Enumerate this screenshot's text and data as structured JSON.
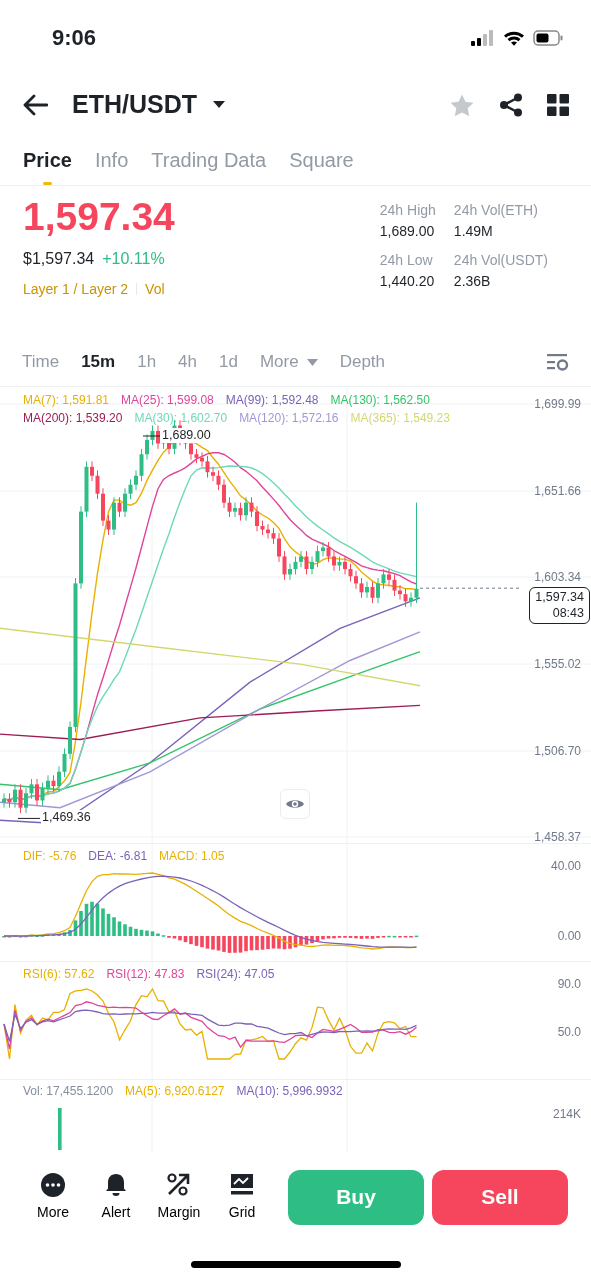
{
  "status_bar": {
    "time": "9:06"
  },
  "header": {
    "pair": "ETH/USDT",
    "favorited": false
  },
  "tabs": [
    {
      "label": "Price",
      "selected": true
    },
    {
      "label": "Info",
      "selected": false
    },
    {
      "label": "Trading Data",
      "selected": false
    },
    {
      "label": "Square",
      "selected": false
    }
  ],
  "price": {
    "last": "1,597.34",
    "usd": "$1,597.34",
    "change": "+10.11%",
    "tags": [
      "Layer 1 / Layer 2",
      "Vol"
    ]
  },
  "stats": [
    {
      "label": "24h High",
      "value": "1,689.00"
    },
    {
      "label": "24h Vol(ETH)",
      "value": "1.49M"
    },
    {
      "label": "24h Low",
      "value": "1,440.20"
    },
    {
      "label": "24h Vol(USDT)",
      "value": "2.36B"
    }
  ],
  "intervals": [
    {
      "label": "Time",
      "selected": false,
      "kind": "plain"
    },
    {
      "label": "15m",
      "selected": true,
      "kind": "plain"
    },
    {
      "label": "1h",
      "selected": false,
      "kind": "plain"
    },
    {
      "label": "4h",
      "selected": false,
      "kind": "plain"
    },
    {
      "label": "1d",
      "selected": false,
      "kind": "plain"
    },
    {
      "label": "More",
      "selected": false,
      "kind": "dropdown"
    },
    {
      "label": "Depth",
      "selected": false,
      "kind": "plain"
    }
  ],
  "price_chart": {
    "legend": [
      {
        "label": "MA(7): 1,591.81",
        "color": "#e8b100"
      },
      {
        "label": "MA(25): 1,599.08",
        "color": "#e0449a"
      },
      {
        "label": "MA(99): 1,592.48",
        "color": "#7b62b8"
      },
      {
        "label": "MA(130): 1,562.50",
        "color": "#33c46a"
      },
      {
        "label": "MA(200): 1,539.20",
        "color": "#9c1c55"
      },
      {
        "label": "MA(30): 1,602.70",
        "color": "#6ed8b8"
      },
      {
        "label": "MA(120): 1,572.16",
        "color": "#9f97d8"
      },
      {
        "label": "MA(365): 1,549.23",
        "color": "#d2d86e"
      }
    ],
    "y_labels": [
      "1,699.99",
      "1,651.66",
      "1,603.34",
      "1,555.02",
      "1,506.70",
      "1,458.37"
    ],
    "high_label": "1,689.00",
    "low_label": "1,469.36",
    "current_price": "1,597.34",
    "countdown": "08:43"
  },
  "macd": {
    "legend": [
      {
        "label": "DIF: -5.76",
        "color": "#e8b100"
      },
      {
        "label": "DEA: -6.81",
        "color": "#7b62b8"
      },
      {
        "label": "MACD: 1.05",
        "color": "#e8b100"
      }
    ],
    "y_labels": [
      "40.00",
      "0.00"
    ]
  },
  "rsi": {
    "legend": [
      {
        "label": "RSI(6): 57.62",
        "color": "#e8b100"
      },
      {
        "label": "RSI(12): 47.83",
        "color": "#e0449a"
      },
      {
        "label": "RSI(24): 47.05",
        "color": "#7b62b8"
      }
    ],
    "y_labels": [
      "90.0",
      "50.0"
    ]
  },
  "volume": {
    "legend": [
      {
        "label": "Vol: 17,455.1200",
        "color": "#848e9c"
      },
      {
        "label": "MA(5): 6,920.6127",
        "color": "#e8b100"
      },
      {
        "label": "MA(10): 5,996.9932",
        "color": "#7b62b8"
      }
    ],
    "y_labels": [
      "214K"
    ]
  },
  "bottom_actions": [
    {
      "label": "More",
      "kind": "more"
    },
    {
      "label": "Alert",
      "kind": "alert"
    },
    {
      "label": "Margin",
      "kind": "margin"
    },
    {
      "label": "Grid",
      "kind": "grid"
    }
  ],
  "buttons": [
    {
      "label": "Buy",
      "kind": "buy"
    },
    {
      "label": "Sell",
      "kind": "sell"
    }
  ]
}
